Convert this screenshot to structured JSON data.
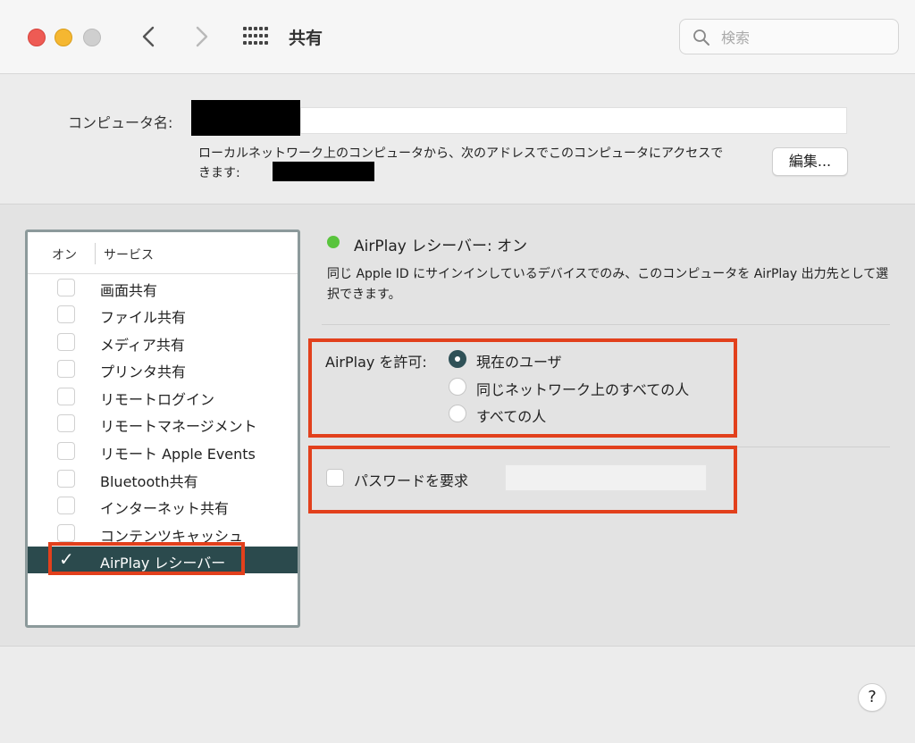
{
  "window": {
    "title": "共有"
  },
  "search": {
    "placeholder": "検索"
  },
  "computer": {
    "name_label": "コンピュータ名:",
    "address_description": "ローカルネットワーク上のコンピュータから、次のアドレスでこのコンピュータにアクセスできます:",
    "edit_label": "編集..."
  },
  "services": {
    "header_on": "オン",
    "header_service": "サービス",
    "items": [
      {
        "label": "画面共有",
        "checked": false
      },
      {
        "label": "ファイル共有",
        "checked": false
      },
      {
        "label": "メディア共有",
        "checked": false
      },
      {
        "label": "プリンタ共有",
        "checked": false
      },
      {
        "label": "リモートログイン",
        "checked": false
      },
      {
        "label": "リモートマネージメント",
        "checked": false
      },
      {
        "label": "リモート Apple Events",
        "checked": false
      },
      {
        "label": "Bluetooth共有",
        "checked": false
      },
      {
        "label": "インターネット共有",
        "checked": false
      },
      {
        "label": "コンテンツキャッシュ",
        "checked": false
      },
      {
        "label": "AirPlay レシーバー",
        "checked": true,
        "selected": true
      }
    ]
  },
  "detail": {
    "status_text": "AirPlay レシーバー: オン",
    "status_color": "#59c43d",
    "description": "同じ Apple ID にサインインしているデバイスでのみ、このコンピュータを AirPlay 出力先として選択できます。",
    "allow_label": "AirPlay を許可:",
    "allow_options": [
      {
        "label": "現在のユーザ",
        "selected": true
      },
      {
        "label": "同じネットワーク上のすべての人",
        "selected": false
      },
      {
        "label": "すべての人",
        "selected": false
      }
    ],
    "password_label": "パスワードを要求",
    "password_checked": false
  },
  "help_label": "?",
  "colors": {
    "highlight_red": "#e2401c",
    "selection": "#2b4a4d"
  }
}
